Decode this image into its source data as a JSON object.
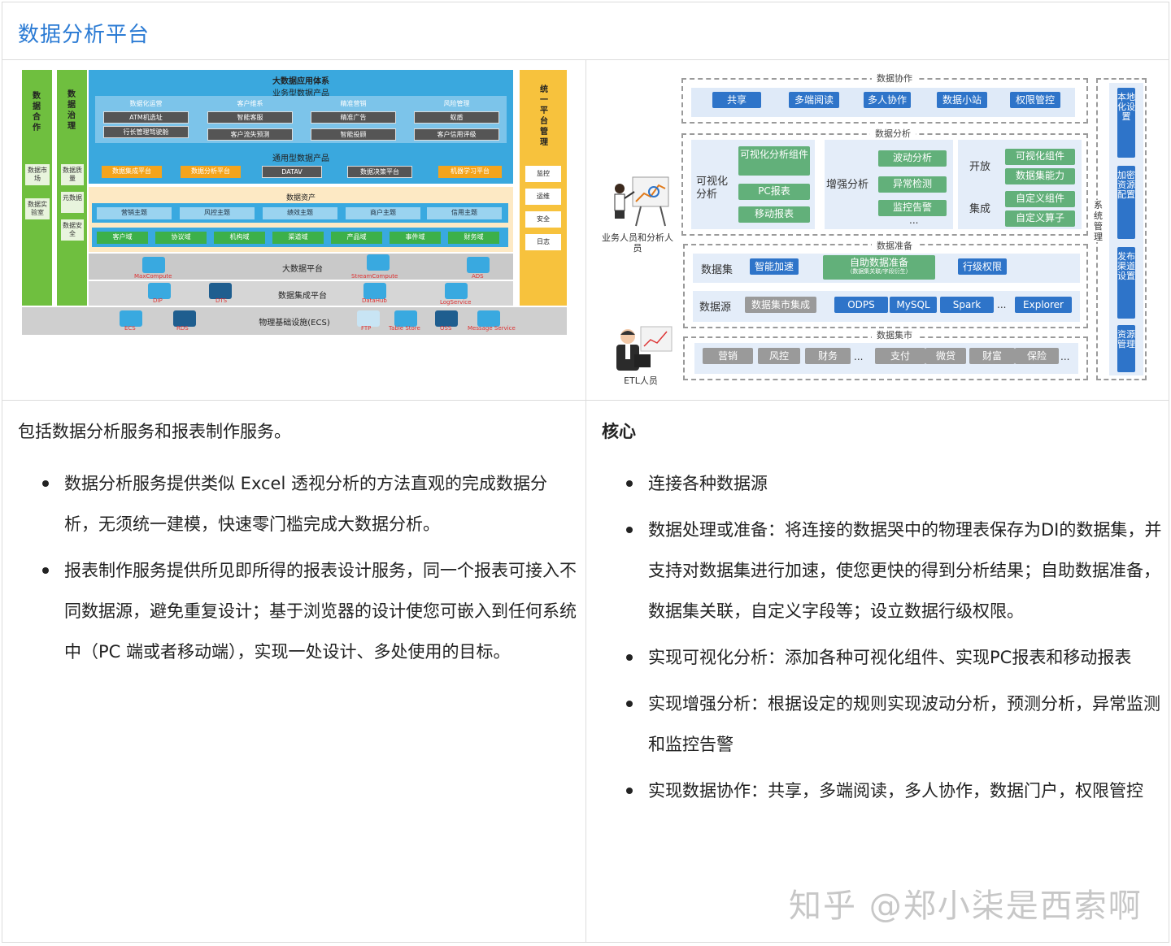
{
  "page": {
    "title": "数据分析平台"
  },
  "left_diagram": {
    "side_left": {
      "title": "数据合作",
      "items": [
        "数据市场",
        "数据实验室"
      ]
    },
    "side_left2": {
      "title": "数据治理",
      "items": [
        "数据质量",
        "元数据",
        "数据安全"
      ]
    },
    "top_title": "大数据应用体系",
    "business_title": "业务型数据产品",
    "business_groups": [
      {
        "name": "数据化运营",
        "items": [
          "ATM机选址",
          "行长管理驾驶舱"
        ]
      },
      {
        "name": "客户维系",
        "items": [
          "智能客服",
          "客户流失预测"
        ]
      },
      {
        "name": "精准营销",
        "items": [
          "精准广告",
          "智能投顾"
        ]
      },
      {
        "name": "风险管理",
        "items": [
          "蚁盾",
          "客户信用评级"
        ]
      }
    ],
    "general_title": "通用型数据产品",
    "general_items": [
      "数据集成平台",
      "数据分析平台",
      "DATAV",
      "数据决策平台",
      "机器学习平台"
    ],
    "assets_title": "数据资产",
    "themes": [
      "营销主题",
      "风控主题",
      "绩效主题",
      "商户主题",
      "信用主题"
    ],
    "domains": [
      "客户域",
      "协议域",
      "机构域",
      "渠道域",
      "产品域",
      "事件域",
      "财务域"
    ],
    "bigdata_platform": "大数据平台",
    "bigdata_icons": [
      "MaxCompute",
      "StreamCompute",
      "ADS"
    ],
    "integration_platform": "数据集成平台",
    "integration_icons": [
      "DIP",
      "DTS",
      "DataHub",
      "LogService"
    ],
    "infra": "物理基础设施(ECS)",
    "infra_icons": [
      "ECS",
      "RDS",
      "FTP",
      "Table Store",
      "OSS",
      "Message Service"
    ],
    "side_right": {
      "title": "统一平台管理",
      "items": [
        "监控",
        "运维",
        "安全",
        "日志"
      ]
    }
  },
  "right_diagram": {
    "collab": {
      "title": "数据协作",
      "items": [
        "共享",
        "多端阅读",
        "多人协作",
        "数据小站",
        "权限管控"
      ]
    },
    "analysis": {
      "title": "数据分析",
      "visual_label": "可视化分析",
      "visual_items": [
        "可视化分析组件",
        "PC报表",
        "移动报表"
      ],
      "enhanced_label": "增强分析",
      "enhanced_items": [
        "波动分析",
        "异常检测",
        "监控告警"
      ],
      "ellipsis": "...",
      "open_label": "开放",
      "integrate_label": "集成",
      "open_items": [
        "可视化组件",
        "数据集能力",
        "自定义组件",
        "自定义算子"
      ]
    },
    "prep": {
      "title": "数据准备",
      "dataset_label": "数据集",
      "dataset_items": [
        "智能加速",
        "自助数据准备",
        "行级权限"
      ],
      "self_prep_sub": "（数据集关联/字段衍生）",
      "source_label": "数据源",
      "source_items": [
        "数据集市集成",
        "ODPS",
        "MySQL",
        "Spark",
        "...",
        "Explorer"
      ]
    },
    "mart": {
      "title": "数据集市",
      "items": [
        "营销",
        "风控",
        "财务",
        "...",
        "支付",
        "微贷",
        "财富",
        "保险",
        "..."
      ]
    },
    "system": {
      "title": "系统管理",
      "items": [
        "本地化设置",
        "加密资源配置",
        "发布渠道设置",
        "资源管理"
      ]
    },
    "persons": [
      "业务人员和分析人员",
      "ETL人员"
    ]
  },
  "left_text": {
    "intro": "包括数据分析服务和报表制作服务。",
    "bullets": [
      "数据分析服务提供类似 Excel 透视分析的方法直观的完成数据分析，无须统一建模，快速零门槛完成大数据分析。",
      "报表制作服务提供所见即所得的报表设计服务，同一个报表可接入不同数据源，避免重复设计；基于浏览器的设计使您可嵌入到任何系统中（PC 端或者移动端），实现一处设计、多处使用的目标。"
    ]
  },
  "right_text": {
    "title": "核心",
    "bullets": [
      "连接各种数据源",
      "数据处理或准备：将连接的数据哭中的物理表保存为DI的数据集，并支持对数据集进行加速，使您更快的得到分析结果；自助数据准备，数据集关联，自定义字段等；设立数据行级权限。",
      "实现可视化分析：添加各种可视化组件、实现PC报表和移动报表",
      "实现增强分析：根据设定的规则实现波动分析，预测分析，异常监测和监控告警",
      "实现数据协作：共享，多端阅读，多人协作，数据门户，权限管控"
    ]
  },
  "watermark": "知乎 @郑小柒是西索啊"
}
